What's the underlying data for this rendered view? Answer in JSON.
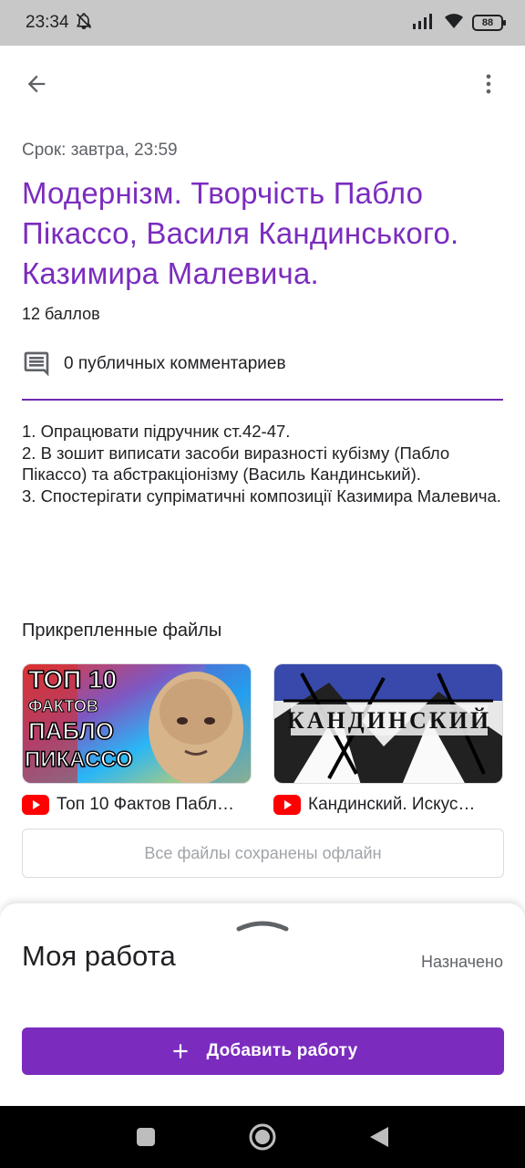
{
  "status_bar": {
    "time": "23:34",
    "battery": "88"
  },
  "assignment": {
    "due": "Срок: завтра, 23:59",
    "title": "Модернізм. Творчість Пабло Пікассо, Василя Кандинського. Казимира Малевича.",
    "points": "12 баллов",
    "comments": "0 публичных комментариев",
    "description": "1. Опрацювати підручник ст.42-47.\n2. В зошит виписати засоби виразності кубізму (Пабло Пікассо) та абстракціонізму (Василь Кандинський).\n3. Спостерігати супріматичні композиції Казимира Малевича."
  },
  "attachments": {
    "heading": "Прикрепленные файлы",
    "items": [
      {
        "label": "Топ 10 Фактов Пабл…",
        "thumb_lines": [
          "ТОП 10",
          "ФАКТОВ",
          "ПАБЛО",
          "ПИКАССО"
        ]
      },
      {
        "label": "Кандинский. Искус…",
        "thumb_text": "КАНДИНСКИЙ"
      }
    ],
    "offline_label": "Все файлы сохранены офлайн"
  },
  "my_work": {
    "title": "Моя работа",
    "status": "Назначено",
    "add_button": "Добавить работу"
  },
  "colors": {
    "accent": "#7b2cbf",
    "youtube": "#ff0000"
  },
  "icons": [
    "back-arrow-icon",
    "more-vert-icon",
    "comment-icon",
    "youtube-icon",
    "plus-icon",
    "bell-off-icon",
    "signal-icon",
    "wifi-icon"
  ]
}
